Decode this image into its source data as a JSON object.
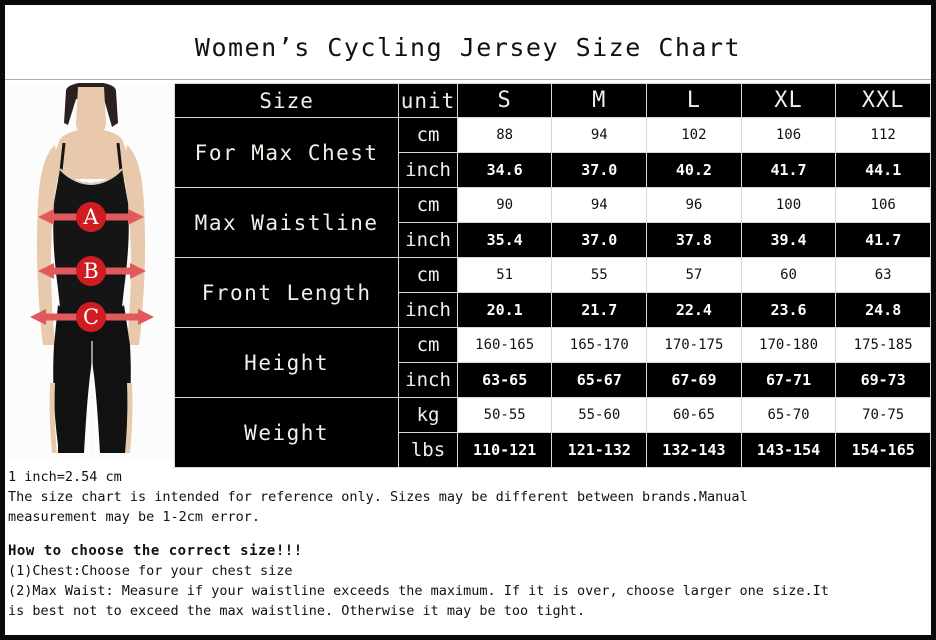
{
  "title": "Women’s Cycling Jersey Size Chart",
  "colors": {
    "frame": "#0a0a0a",
    "table_bg": "#000000",
    "grid": "#d8d8d8",
    "value_light_bg": "#ffffff",
    "value_light_fg": "#111111",
    "value_dark_bg": "#000000",
    "value_dark_fg": "#ffffff",
    "arrow_red": "#d8232a",
    "arrow_red_light": "#e8686b",
    "garment_black": "#1b1b1b",
    "skin": "#e8c9ac"
  },
  "photo": {
    "name": "model-measurement-diagram",
    "markers": [
      "A",
      "B",
      "C"
    ],
    "marker_meanings": {
      "A": "chest",
      "B": "waist",
      "C": "hip"
    }
  },
  "chart_data": {
    "type": "table",
    "title": "Women’s Cycling Jersey Size Chart",
    "header": {
      "label_col": "Size",
      "unit_col": "unit",
      "sizes": [
        "S",
        "M",
        "L",
        "XL",
        "XXL"
      ]
    },
    "rows": [
      {
        "label": "For Max Chest",
        "units": [
          {
            "unit": "cm",
            "style": "light",
            "values": [
              "88",
              "94",
              "102",
              "106",
              "112"
            ]
          },
          {
            "unit": "inch",
            "style": "dark",
            "values": [
              "34.6",
              "37.0",
              "40.2",
              "41.7",
              "44.1"
            ]
          }
        ]
      },
      {
        "label": "Max Waistline",
        "units": [
          {
            "unit": "cm",
            "style": "light",
            "values": [
              "90",
              "94",
              "96",
              "100",
              "106"
            ]
          },
          {
            "unit": "inch",
            "style": "dark",
            "values": [
              "35.4",
              "37.0",
              "37.8",
              "39.4",
              "41.7"
            ]
          }
        ]
      },
      {
        "label": "Front Length",
        "units": [
          {
            "unit": "cm",
            "style": "light",
            "values": [
              "51",
              "55",
              "57",
              "60",
              "63"
            ]
          },
          {
            "unit": "inch",
            "style": "dark",
            "values": [
              "20.1",
              "21.7",
              "22.4",
              "23.6",
              "24.8"
            ]
          }
        ]
      },
      {
        "label": "Height",
        "units": [
          {
            "unit": "cm",
            "style": "light",
            "values": [
              "160-165",
              "165-170",
              "170-175",
              "170-180",
              "175-185"
            ]
          },
          {
            "unit": "inch",
            "style": "dark",
            "values": [
              "63-65",
              "65-67",
              "67-69",
              "67-71",
              "69-73"
            ]
          }
        ]
      },
      {
        "label": "Weight",
        "units": [
          {
            "unit": "kg",
            "style": "light",
            "values": [
              "50-55",
              "55-60",
              "60-65",
              "65-70",
              "70-75"
            ]
          },
          {
            "unit": "lbs",
            "style": "dark",
            "values": [
              "110-121",
              "121-132",
              "132-143",
              "143-154",
              "154-165"
            ]
          }
        ]
      }
    ]
  },
  "notes": {
    "conversion": "1 inch=2.54 cm",
    "disclaimer_line1": "The size chart is intended for reference only. Sizes may be different between brands.Manual",
    "disclaimer_line2": "measurement may be 1-2cm error.",
    "howto_heading": "How to choose the correct size!!!",
    "howto_line1": "(1)Chest:Choose for your chest size",
    "howto_line2": "(2)Max Waist: Measure if your waistline exceeds the maximum. If it is over, choose larger one size.It",
    "howto_line3": "is best not to exceed the max waistline. Otherwise it may be too tight."
  }
}
